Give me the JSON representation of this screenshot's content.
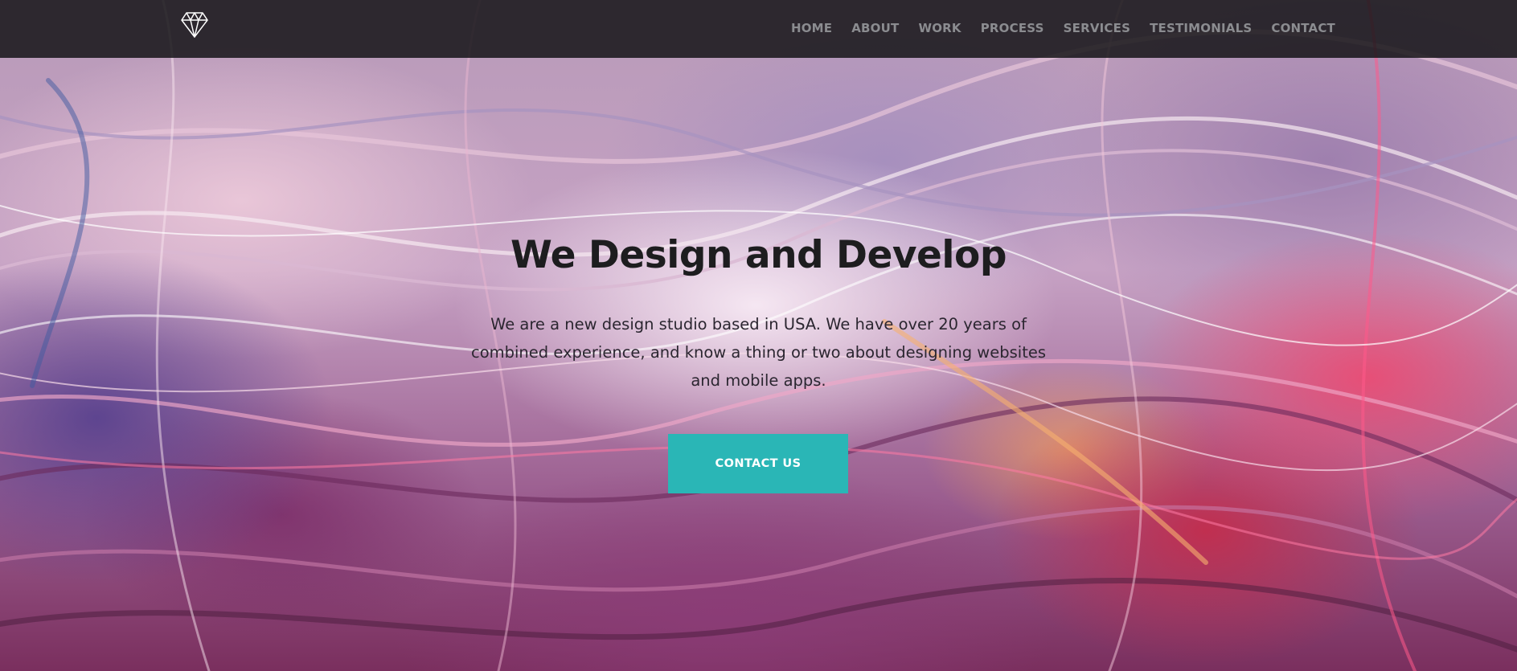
{
  "nav": {
    "logo": "diamond-icon",
    "items": [
      {
        "label": "HOME"
      },
      {
        "label": "ABOUT"
      },
      {
        "label": "WORK"
      },
      {
        "label": "PROCESS"
      },
      {
        "label": "SERVICES"
      },
      {
        "label": "TESTIMONIALS"
      },
      {
        "label": "CONTACT"
      }
    ]
  },
  "hero": {
    "headline": "We Design and Develop",
    "description": "We are a new design studio based in USA. We have over 20 years of combined experience, and know a thing or two about designing websites and mobile apps.",
    "cta_label": "CONTACT US"
  },
  "colors": {
    "navbar_bg": "#121214",
    "nav_text": "#8b8c90",
    "cta_bg": "#2ab6b6",
    "headline": "#1d1d1f"
  }
}
